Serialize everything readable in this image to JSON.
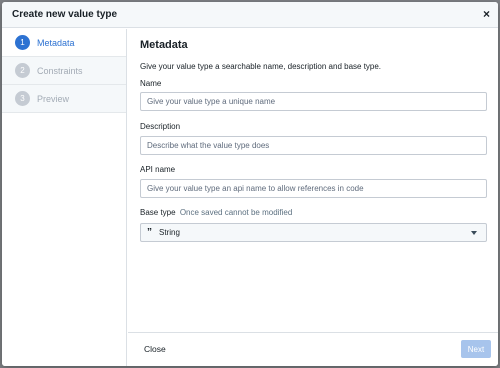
{
  "dialog": {
    "title": "Create new value type",
    "close_icon": "×"
  },
  "steps": [
    {
      "number": "1",
      "label": "Metadata",
      "active": true
    },
    {
      "number": "2",
      "label": "Constraints",
      "active": false
    },
    {
      "number": "3",
      "label": "Preview",
      "active": false
    }
  ],
  "main": {
    "title": "Metadata",
    "intro": "Give your value type a searchable name, description and base type.",
    "fields": {
      "name": {
        "label": "Name",
        "value": "",
        "placeholder": "Give your value type a unique name"
      },
      "description": {
        "label": "Description",
        "value": "",
        "placeholder": "Describe what the value type does"
      },
      "api_name": {
        "label": "API name",
        "value": "",
        "placeholder": "Give your value type an api name to allow references in code"
      },
      "base_type": {
        "label": "Base type",
        "hint": "Once saved cannot be modified",
        "selected": "String",
        "icon": "quote-icon"
      }
    }
  },
  "footer": {
    "close_label": "Close",
    "next_label": "Next"
  },
  "colors": {
    "accent": "#2d72d2",
    "next_disabled": "#a7c4ec"
  }
}
